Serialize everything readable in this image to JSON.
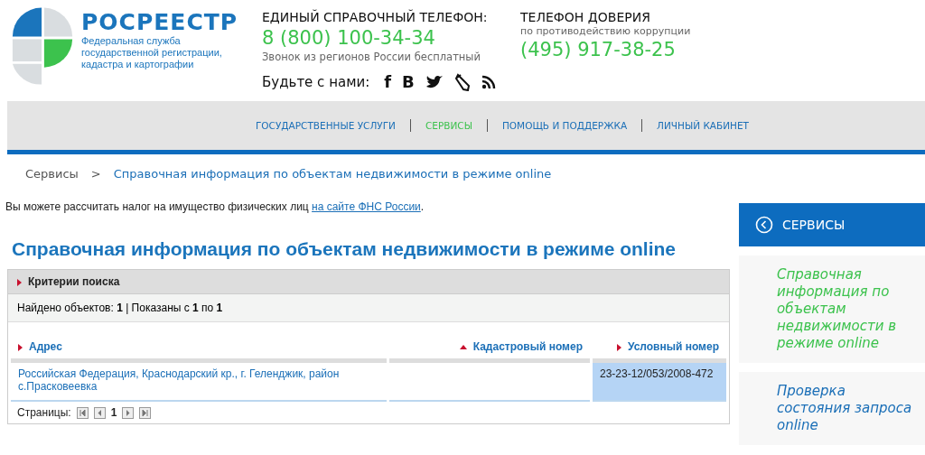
{
  "logo": {
    "name": "РОСРЕЕСТР",
    "subtitle": "Федеральная служба государственной регистрации, кадастра и картографии"
  },
  "hotline": {
    "title": "ЕДИНЫЙ СПРАВОЧНЫЙ ТЕЛЕФОН:",
    "phone": "8 (800) 100-34-34",
    "note": "Звонок из регионов России бесплатный"
  },
  "trust_line": {
    "title": "ТЕЛЕФОН ДОВЕРИЯ",
    "note": "по противодействию коррупции",
    "phone": "(495) 917-38-25"
  },
  "social": {
    "label": "Будьте с нами:",
    "icons": [
      {
        "kind": "glyph",
        "text": "f"
      },
      {
        "kind": "glyph",
        "text": "B"
      },
      {
        "kind": "bird"
      },
      {
        "kind": "pencil"
      },
      {
        "kind": "rss"
      }
    ]
  },
  "nav": [
    {
      "label": "ГОСУДАРСТВЕННЫЕ УСЛУГИ",
      "selected": false
    },
    {
      "label": "СЕРВИСЫ",
      "selected": true
    },
    {
      "label": "ПОМОЩЬ И ПОДДЕРЖКА",
      "selected": false
    },
    {
      "label": "ЛИЧНЫЙ КАБИНЕТ",
      "selected": false
    }
  ],
  "breadcrumb": {
    "items": [
      "Сервисы",
      "Справочная информация по объектам недвижимости в режиме online"
    ],
    "separator": ">"
  },
  "notice": {
    "text": "Вы можете рассчитать налог на имущество физических лиц",
    "link": "на сайте ФНС России",
    "end": "."
  },
  "page_title": "Справочная информация по объектам недвижимости в режиме online",
  "search_panel": {
    "title": "Критерии поиска",
    "summary": "Найдено объектов: **1** | Показаны с **1** по **1**"
  },
  "table": {
    "columns": [
      {
        "label": "Адрес",
        "sorted": false
      },
      {
        "label": "Кадастровый номер",
        "sorted": true
      },
      {
        "label": "Условный номер",
        "sorted": false
      }
    ],
    "rows": [
      {
        "cells": [
          {
            "text": "Российская Федерация, Краснодарский кр., г. Геленджик, район с.Прасковеевка",
            "selected": false
          },
          {
            "selected": false
          },
          {
            "text": "23-23-12/053/2008-472",
            "selected": true
          }
        ]
      }
    ]
  },
  "pager": {
    "label": "Страницы:",
    "page": "1"
  },
  "sidebar": {
    "title": "СЕРВИСЫ",
    "items": [
      {
        "label": "Справочная информация по объектам недвижимости в режиме online",
        "selected": true
      },
      {
        "label": "Проверка состояния запроса online",
        "selected": false
      }
    ]
  }
}
